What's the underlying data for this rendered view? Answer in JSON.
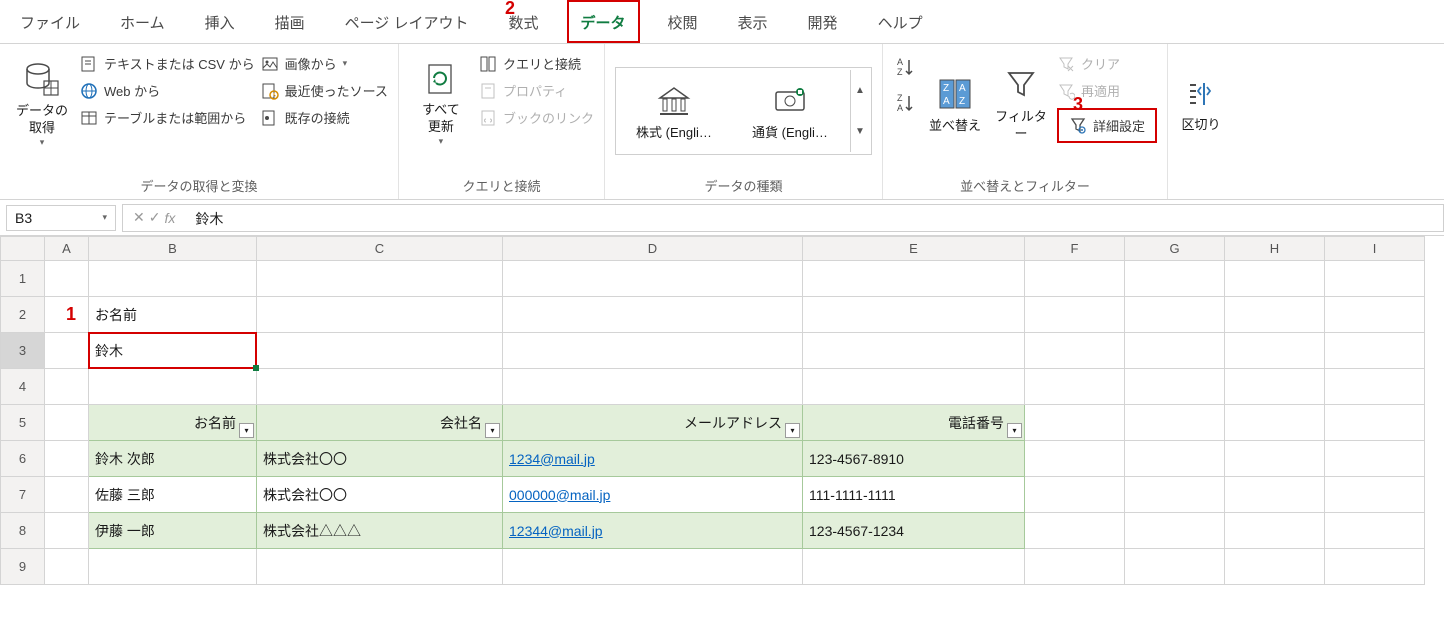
{
  "annotations": {
    "one": "1",
    "two": "2",
    "three": "3"
  },
  "tabs": [
    "ファイル",
    "ホーム",
    "挿入",
    "描画",
    "ページ レイアウト",
    "数式",
    "データ",
    "校閲",
    "表示",
    "開発",
    "ヘルプ"
  ],
  "ribbon": {
    "group1": {
      "get_data": "データの\n取得",
      "items": [
        "テキストまたは CSV から",
        "画像から",
        "Web から",
        "最近使ったソース",
        "テーブルまたは範囲から",
        "既存の接続"
      ],
      "label": "データの取得と変換"
    },
    "group2": {
      "refresh": "すべて\n更新",
      "items": [
        "クエリと接続",
        "プロパティ",
        "ブックのリンク"
      ],
      "label": "クエリと接続"
    },
    "group3": {
      "stocks": "株式 (Engli…",
      "currency": "通貨 (Engli…",
      "label": "データの種類"
    },
    "group4": {
      "sort": "並べ替え",
      "filter": "フィルター",
      "items": [
        "クリア",
        "再適用",
        "詳細設定"
      ],
      "label": "並べ替えとフィルター"
    },
    "group5": {
      "split": "区切り"
    }
  },
  "formula_bar": {
    "cell_ref": "B3",
    "value": "鈴木"
  },
  "columns": [
    "A",
    "B",
    "C",
    "D",
    "E",
    "F",
    "G",
    "H",
    "I"
  ],
  "rows": [
    "1",
    "2",
    "3",
    "4",
    "5",
    "6",
    "7",
    "8",
    "9"
  ],
  "cells": {
    "criteria_header": "お名前",
    "criteria_value": "鈴木",
    "headers": [
      "お名前",
      "会社名",
      "メールアドレス",
      "電話番号"
    ],
    "data": [
      {
        "name": "鈴木 次郎",
        "company": "株式会社〇〇",
        "mail": "1234@mail.jp",
        "tel": "123-4567-8910"
      },
      {
        "name": "佐藤 三郎",
        "company": "株式会社〇〇",
        "mail": "000000@mail.jp",
        "tel": "111-1111-1111"
      },
      {
        "name": "伊藤 一郎",
        "company": "株式会社△△△",
        "mail": "12344@mail.jp",
        "tel": "123-4567-1234"
      }
    ]
  }
}
